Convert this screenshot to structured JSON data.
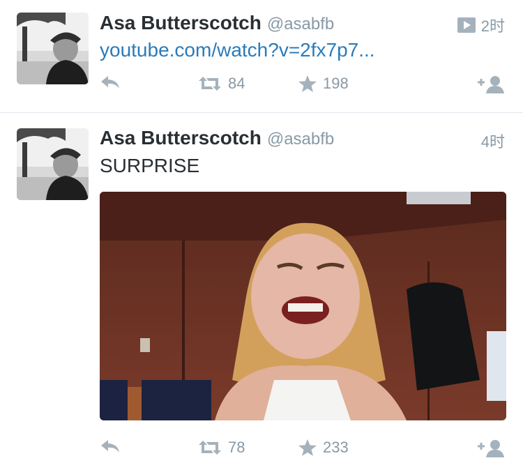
{
  "tweets": [
    {
      "user_name": "Asa Butterscotch",
      "handle": "@asabfb",
      "time": "2时",
      "text": "youtube.com/watch?v=2fx7p7...",
      "has_media_badge": true,
      "retweets": "84",
      "favorites": "198"
    },
    {
      "user_name": "Asa Butterscotch",
      "handle": "@asabfb",
      "time": "4时",
      "text": "SURPRISE",
      "has_media_badge": false,
      "retweets": "78",
      "favorites": "233"
    }
  ],
  "colors": {
    "link": "#2b7bb9",
    "muted": "#8899a6",
    "text": "#292f33",
    "divider": "#e1e8ed"
  },
  "icons": {
    "reply": "reply-arrow-icon",
    "retweet": "retweet-icon",
    "favorite": "star-icon",
    "follow": "add-user-icon",
    "media": "play-badge-icon"
  }
}
